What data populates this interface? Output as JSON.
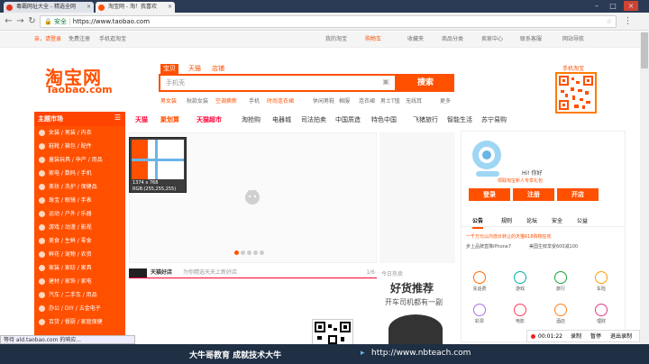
{
  "browser": {
    "tabs": [
      {
        "label": "毒霸网址大全 - 精选全网",
        "active": false
      },
      {
        "label": "淘宝网 - 淘！我喜欢",
        "active": true
      }
    ],
    "address_security": "安全",
    "url": "https://www.taobao.com"
  },
  "topnav": {
    "greeting": "亲，请登录",
    "register": "免费注册",
    "mobile": "手机逛淘宝",
    "links": [
      "我的淘宝",
      "购物车",
      "收藏夹",
      "商品分类",
      "卖家中心",
      "联系客服",
      "网站导航"
    ]
  },
  "logo": {
    "cn": "淘宝网",
    "en": "Taobao.com"
  },
  "search": {
    "tabs": [
      "宝贝",
      "天猫",
      "店铺"
    ],
    "placeholder": "手机壳",
    "button": "搜索",
    "hot": [
      "男女装",
      "秋款女装",
      "空调换新",
      "手机",
      "时尚连衣裙",
      "休闲男鞋",
      "棉服",
      "连衣裙",
      "男士T恤",
      "无线耳",
      "更多"
    ]
  },
  "qr": {
    "label": "手机淘宝"
  },
  "catnav": {
    "items": [
      "天猫",
      "聚划算",
      "天猫超市",
      "淘抢购",
      "电器城",
      "司法拍卖",
      "中国质造",
      "特色中国",
      "飞猪旅行",
      "智能生活",
      "苏宁易购"
    ]
  },
  "sidebar": {
    "title": "主题市场",
    "items": [
      "女装 / 男装 / 内衣",
      "鞋靴 / 箱包 / 配件",
      "童装玩具 / 孕产 / 用品",
      "家电 / 数码 / 手机",
      "美妆 / 洗护 / 保健品",
      "珠宝 / 眼镜 / 手表",
      "运动 / 户外 / 乐器",
      "游戏 / 动漫 / 影视",
      "美食 / 生鲜 / 零食",
      "鲜花 / 宠物 / 农资",
      "家装 / 家纺 / 家具",
      "建材 / 家饰 / 家电",
      "汽车 / 二手车 / 用品",
      "办公 / DIY / 五金电子",
      "百货 / 餐厨 / 家庭保健"
    ]
  },
  "tooltip": {
    "size": "1374 x 768",
    "rgb": "RGB:(255,255,255)"
  },
  "tmall": {
    "label": "天猫好店",
    "sub": "为你精选天天上新好店",
    "page": "1/6"
  },
  "good": {
    "tag": "今日热卖",
    "title": "好货推荐",
    "sub": "开车司机都有一副"
  },
  "rpanel": {
    "hi": "Hi! 你好",
    "promo": "领取淘宝新人专享礼包",
    "buttons": [
      "登录",
      "注册",
      "开店"
    ],
    "tabs": [
      "公告",
      "规则",
      "论坛",
      "安全",
      "公益"
    ],
    "news": [
      "一千万元以内低价转让的天猫618购物狂欢",
      "步上品牌直降iPhone7",
      "美国生鲜享受600减100"
    ],
    "grid": [
      {
        "label": "充话费",
        "color": "#ff6a00"
      },
      {
        "label": "游戏",
        "color": "#00b1a7"
      },
      {
        "label": "旅行",
        "color": "#19a33a"
      },
      {
        "label": "车险",
        "color": "#ff9e00"
      },
      {
        "label": "彩票",
        "color": "#b06be6"
      },
      {
        "label": "电影",
        "color": "#ff3b5a"
      },
      {
        "label": "酒店",
        "color": "#ff7f1e"
      },
      {
        "label": "理财",
        "color": "#e83a8c"
      }
    ]
  },
  "recorder": {
    "time": "00:01:22",
    "items": [
      "录制",
      "暂停",
      "退出录制"
    ]
  },
  "status": "等待 ald.taobao.com 的响应...",
  "bottombar": {
    "left": "大牛哥教育 成就技术大牛",
    "right": "http://www.nbteach.com"
  }
}
